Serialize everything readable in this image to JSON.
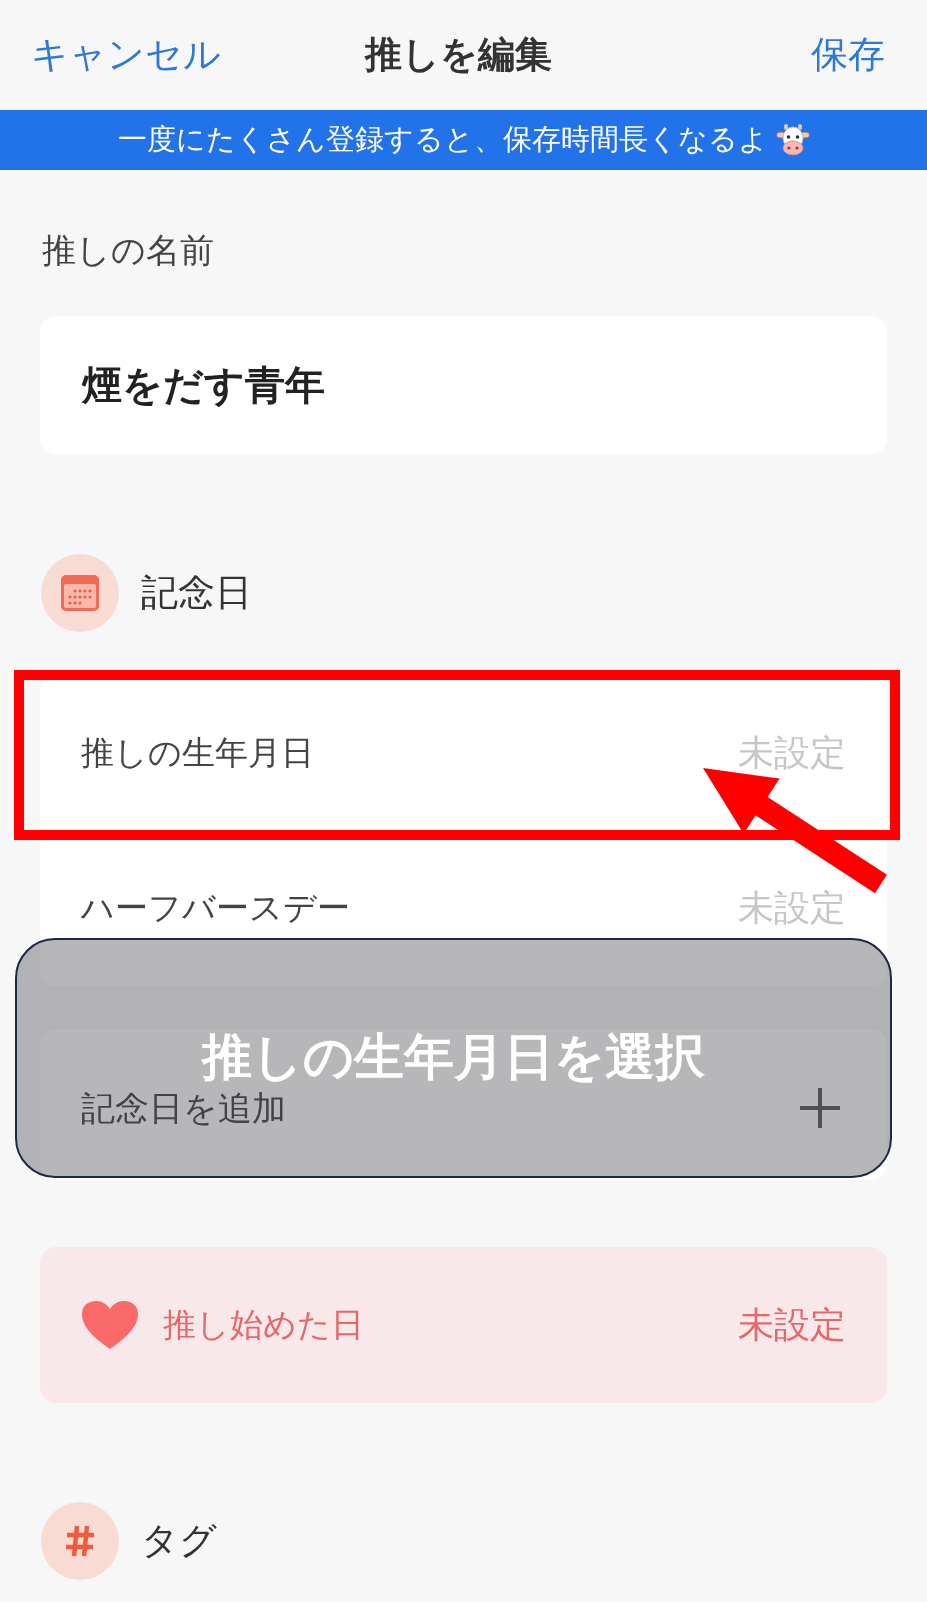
{
  "header": {
    "cancel": "キャンセル",
    "title": "推しを編集",
    "save": "保存"
  },
  "banner": {
    "text": "一度にたくさん登録すると、保存時間長くなるよ"
  },
  "name": {
    "label": "推しの名前",
    "value": "煙をだす青年"
  },
  "anniversary": {
    "title": "記念日",
    "rows": [
      {
        "label": "推しの生年月日",
        "value": "未設定",
        "highlighted": true
      },
      {
        "label": "ハーフバースデー",
        "value": "未設定",
        "highlighted": false
      }
    ],
    "add_label": "記念日を追加"
  },
  "callout": {
    "text": "推しの生年月日を選択"
  },
  "fan_since": {
    "label": "推し始めた日",
    "value": "未設定"
  },
  "tags": {
    "title": "タグ"
  }
}
